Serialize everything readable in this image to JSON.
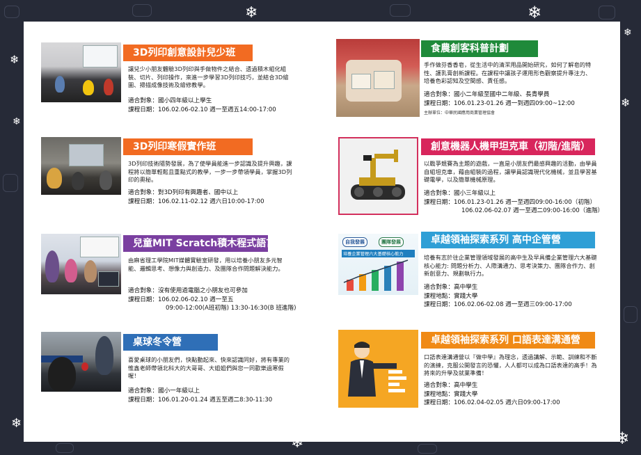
{
  "colors": {
    "background": "#262a37",
    "orange": "#f26b22",
    "purple": "#7a3fa0",
    "blue": "#2f6fb7",
    "green": "#1f8a3a",
    "pink": "#d8265c",
    "sky": "#2f9fd6",
    "amber": "#f08a16"
  },
  "icons": [
    "snowflake-icon",
    "present-doodle-icon"
  ],
  "courses": [
    {
      "title": "3D列印創意設計兒少班",
      "desc": "讓兒少小朋友體驗3D列印與手做物件之結合、透過積木組化組裝、切片、列印操作，來進一步學習3D列印技巧，並結合3D繪圖、掃描成像技術及繪修教學。",
      "target": "適合對象：國小四年級以上學生",
      "date": "課程日期：106.02.06-02.10  週一至週五14:00-17:00"
    },
    {
      "title": "3D列印寒假實作班",
      "desc": "3D列印技術隨勢發展，為了使學員能進一步認識及提升興趣，課程將以簡單輕鬆且重點式的教學，一步一步帶領學員，掌握3D列印的奧秘。",
      "target": "適合對象：對3D列印有興趣者、國中以上",
      "date": "課程日期：106.02.11-02.12  週六日10:00-17:00"
    },
    {
      "title": "兒童MIT Scratch積木程式語言",
      "desc": "由麻省理工學院MIT媒體實驗室研發，用以培養小朋友多元智能、邏輯思考、想像力與創造力、及團隊合作問題解決能力。",
      "target": "適合對象：沒有使用過電腦之小朋友也可參加",
      "date": "課程日期：106.02.06-02.10  週一至五",
      "date2": "09:00-12:00(A班初階)  13:30-16:30(B 班進階)"
    },
    {
      "title": "桌球冬令營",
      "desc": "喜愛桌球的小朋友們，快點動起來、快來認識同好，將有專業的惟鑫老師帶領北科大的大哥哥、大姐姐們與您一同歡樂過寒假喔！",
      "target": "適合對象：國小一年級以上",
      "date": "課程日期：106.01.20-01.24  週五至週二8:30-11:30"
    },
    {
      "title": "食農創客科普計劃",
      "desc": "手作做芬香香皂，從生活中的清潔用品開始研究，如何了解皂的特性、護乳膏創新課程。在課程中讓孩子運用形色觀察提升專注力、培養色彩認知及空間感、責任感。",
      "target": "適合對象：國小二年級至國中二年級、長青學員",
      "date": "課程日期：106.01.23-01.26  週一到週四09:00~12:00",
      "note": "主辦單位：中華民國應用商業管理協會"
    },
    {
      "title": "創意機器人機甲坦克車（初階/進階）",
      "desc": "以戰爭競賽為主題的遊戲，一直是小朋友們最感興趣的活動，由學員自組坦克車，藉由組裝的過程，讓學員認識現代化機械，並且學習基礎電學，以及簡單機械原理。",
      "target": "適合對象：國小三年級以上",
      "date": "課程日期：106.01.23-01.26  週一至週四09:00-16:00（初階）",
      "date2": "106.02.06-02.07  週一至週二09:00-16:00（進階）"
    },
    {
      "title": "卓越領袖探索系列 高中企管營",
      "desc": "培養有志於往企業管理領域發展的高中生及早具備企業管理六大基礎核心能力: 問題分析力、人際溝通力、思考決策力、團隊合作力、創新創意力、規劃執行力。",
      "target": "適合對象：高中學生",
      "place": "課程地點：實踐大學",
      "date": "課程日期：106.02.06-02.08  週一至週三09:00-17:00",
      "image_text_left": "自我發展",
      "image_text_right": "團隊發展",
      "image_caption": "培養企業管理六大基礎核心能力"
    },
    {
      "title": "卓越領袖探索系列 口語表達溝通營",
      "desc": "口語表達溝通營以『做中學』為理念，透過講解、示範、訓練和不斷的演練，克服公開發言的恐懼，人人都可以成為口語表達的高手！為將來的升學及就業準備！",
      "target": "適合對象：高中學生",
      "place": "課程地點：實踐大學",
      "date": "課程日期：106.02.04-02.05  週六日09:00-17:00"
    }
  ]
}
